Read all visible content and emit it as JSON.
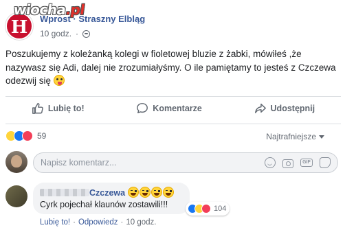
{
  "watermark": {
    "brand": "wiocha",
    "tld": ".pl"
  },
  "post": {
    "page_name": "Wprost · Straszny Elbląg",
    "avatar_letter": "H",
    "time": "10 godz.",
    "text": "Poszukujemy z koleżanką kolegi w fioletowej bluzie z żabki, mówiłeś ,że nazywasz się Adi, dalej nie zrozumiałyśmy. O ile pamiętamy to jesteś z Czczewa odezwij się",
    "text_emoji": "tongue-emoji"
  },
  "actions": {
    "like": "Lubię to!",
    "comment": "Komentarze",
    "share": "Udostępnij"
  },
  "reactions": {
    "icons": [
      "haha",
      "like",
      "love"
    ],
    "count": "59"
  },
  "sort": {
    "label": "Najtrafniejsze"
  },
  "composer": {
    "placeholder": "Napisz komentarz..."
  },
  "comment": {
    "author_suffix": "Czczewa",
    "emojis": [
      "laugh",
      "laugh",
      "laugh",
      "laugh"
    ],
    "text": "Cyrk pojechał klaunów zostawili!!!",
    "reaction_count": "104",
    "like": "Lubię to!",
    "reply": "Odpowiedz",
    "time": "10 godz.",
    "sep": "·"
  },
  "colors": {
    "link": "#385898",
    "like_blue": "#1877f2",
    "love_red": "#f33e58",
    "page_red": "#c8102e"
  }
}
